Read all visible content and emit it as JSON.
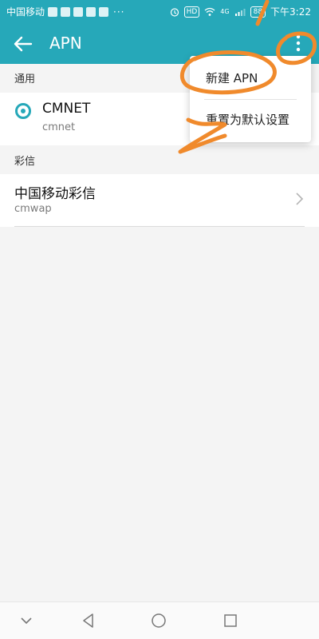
{
  "status_bar": {
    "carrier": "中国移动",
    "more": "···",
    "hd": "HD",
    "signal": "4G",
    "battery": "88",
    "time": "下午3:22"
  },
  "toolbar": {
    "title": "APN",
    "back_icon": "arrow-left-icon",
    "menu_icon": "more-vertical-icon"
  },
  "sections": {
    "general": {
      "header": "通用",
      "item": {
        "title": "CMNET",
        "subtitle": "cmnet",
        "selected": true
      }
    },
    "mms": {
      "header": "彩信",
      "item": {
        "title": "中国移动彩信",
        "subtitle": "cmwap"
      }
    }
  },
  "popup_menu": {
    "items": [
      "新建 APN",
      "重置为默认设置"
    ]
  },
  "colors": {
    "accent": "#26a8b9",
    "annotation": "#f08a2c"
  }
}
